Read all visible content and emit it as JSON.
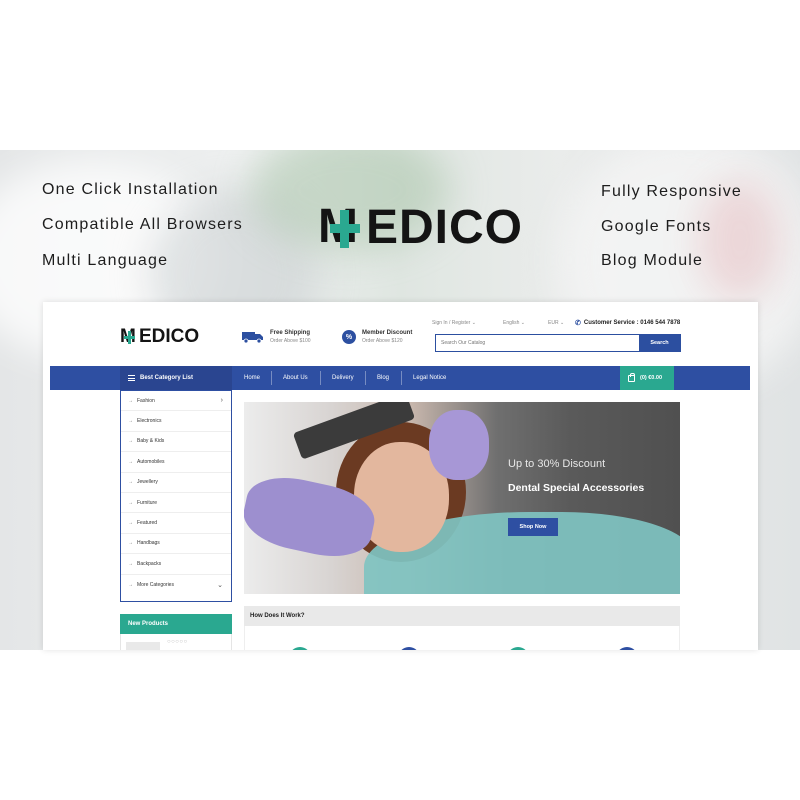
{
  "features_left": [
    "One Click Installation",
    "Compatible All Browsers",
    "Multi Language"
  ],
  "features_right": [
    "Fully Responsive",
    "Google Fonts",
    "Blog Module"
  ],
  "brand": {
    "prefix": "M",
    "rest": "EDICO",
    "hero_rest": "EDICO",
    "accent": "#2aa890",
    "primary": "#2e4fa2"
  },
  "header": {
    "shipping_title": "Free Shipping",
    "shipping_sub": "Order Above $100",
    "member_title": "Member Discount",
    "member_sub": "Order Above $120",
    "member_icon_text": "%",
    "signin": "Sign In / Register",
    "language": "English",
    "currency": "EUR",
    "customer_service": "Customer Service : 0146 544 7878",
    "search_placeholder": "Search Our Catalog",
    "search_button": "Search"
  },
  "nav": {
    "category_label": "Best Category List",
    "items": [
      "Home",
      "About Us",
      "Delivery",
      "Blog",
      "Legal Notice"
    ],
    "cart": "(0) €0.00"
  },
  "categories": [
    "Fashion",
    "Electronics",
    "Baby & Kids",
    "Automobiles",
    "Jewellery",
    "Furniture",
    "Featured",
    "Handbags",
    "Backpacks",
    "More Categories"
  ],
  "sidebar": {
    "new_products": "New Products"
  },
  "hero": {
    "discount": "Up to 30% Discount",
    "title": "Dental Special Accessories",
    "button": "Shop Now"
  },
  "how": {
    "title": "How Does It Work?"
  },
  "icons": {
    "shipping": "truck-icon",
    "discount": "percent-icon",
    "phone": "phone-icon",
    "cart": "shopping-bag-icon",
    "menu": "hamburger-icon"
  }
}
